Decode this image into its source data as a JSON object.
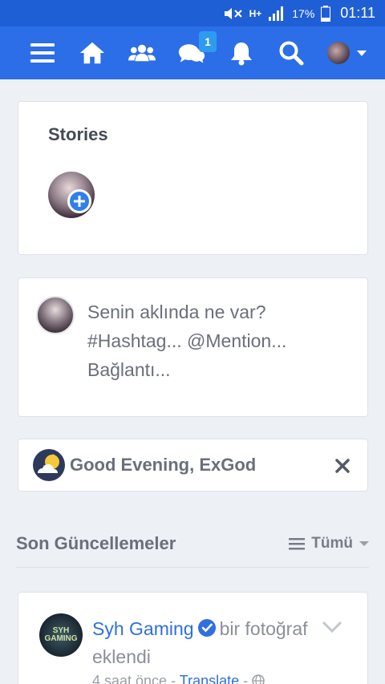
{
  "status_bar": {
    "battery": "17%",
    "time": "01:11",
    "network": "H+"
  },
  "nav": {
    "messages_badge": "1"
  },
  "stories": {
    "title": "Stories"
  },
  "composer": {
    "placeholder": "Senin aklında ne var? #Hashtag... @Mention... Bağlantı..."
  },
  "greeting": {
    "text": "Good Evening, ExGod"
  },
  "feed": {
    "title": "Son Güncellemeler",
    "filter_label": "Tümü"
  },
  "post": {
    "author": "Syh Gaming",
    "action": "bir fotoğraf eklendi",
    "time": "4 saat önce",
    "translate": "Translate",
    "avatar_text": "SYH GAMING"
  },
  "colors": {
    "statusbar": "#1f5fd6",
    "navbar": "#2c6ee8",
    "link": "#2f6fe0",
    "background": "#edf0f5"
  }
}
